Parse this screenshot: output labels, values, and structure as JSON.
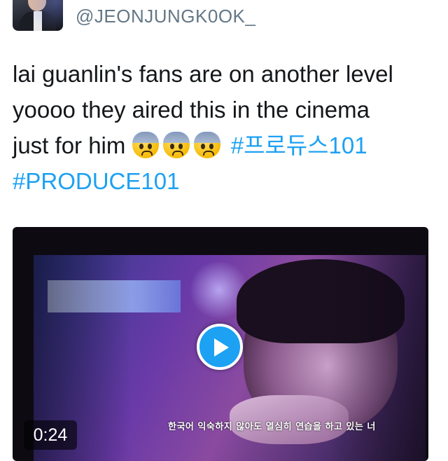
{
  "tweet": {
    "handle": "@JEONJUNGK0OK_",
    "line1": "lai guanlin's fans are on another level",
    "line2": "yoooo they aired this in the cinema",
    "line3_text": "just for him",
    "hashtag1": "#프로듀스101",
    "hashtag2": "#PRODUCE101",
    "emojis": [
      "anxious-face-icon",
      "anxious-face-icon",
      "anxious-face-icon"
    ]
  },
  "video": {
    "duration": "0:24",
    "subtitle": "한국어 익숙하지 않아도 열심히 연습을 하고 있는 너",
    "play_icon": "play-icon"
  },
  "colors": {
    "hashtag": "#1da1f2",
    "handle": "#657786",
    "text": "#14171a",
    "play_button": "#1da1f2"
  }
}
